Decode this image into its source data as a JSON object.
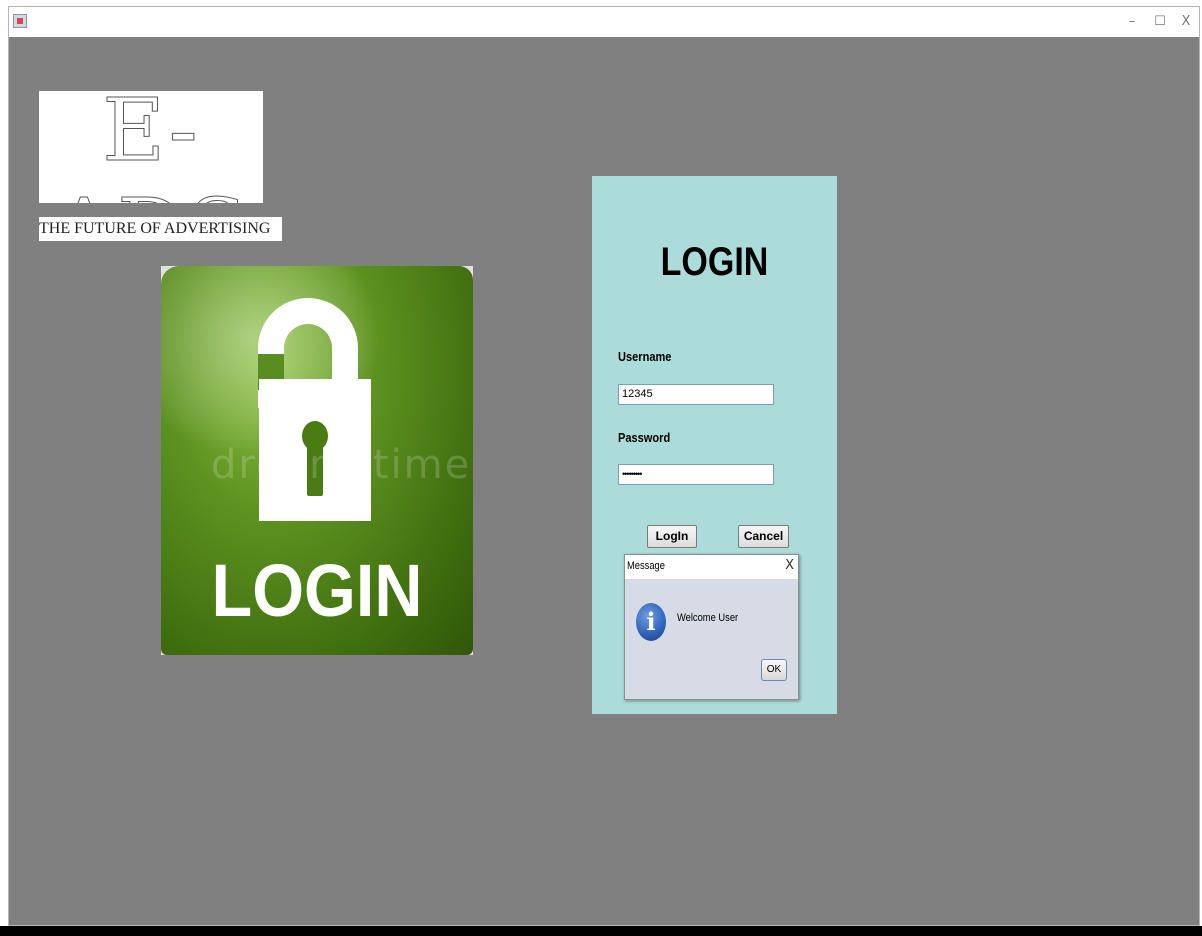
{
  "window": {
    "title": "",
    "controls": {
      "minimize": "–",
      "maximize": "☐",
      "close": "X"
    }
  },
  "branding": {
    "logo_text": "E-ADS",
    "tagline": "THE FUTURE OF ADVERTISING"
  },
  "hero_image": {
    "label": "LOGIN",
    "watermark": "dreamstime."
  },
  "login_panel": {
    "title": "LOGIN",
    "username_label": "Username",
    "username_value": "12345",
    "password_label": "Password",
    "password_value": "•••••••••",
    "login_button": "LogIn",
    "cancel_button": "Cancel"
  },
  "message_dialog": {
    "title": "Message",
    "close": "X",
    "icon": "info-icon",
    "icon_glyph": "i",
    "message": "Welcome User",
    "ok_button": "OK"
  },
  "colors": {
    "background": "#808080",
    "panel": "#acdcd9",
    "lock_green": "#5f9421",
    "dialog_bg": "#d6dbe6"
  }
}
